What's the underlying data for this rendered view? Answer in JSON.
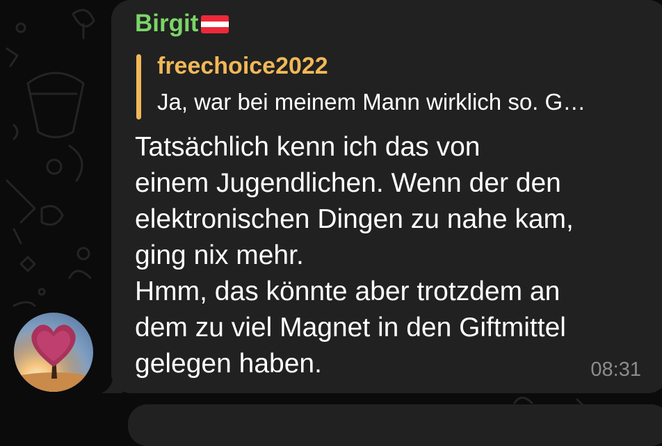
{
  "message": {
    "sender": "Birgit",
    "sender_flag": "austria-flag",
    "sender_color": "#7bd567",
    "reply": {
      "name": "freechoice2022",
      "text": "Ja, war bei meinem Mann wirklich so. G…",
      "accent_color": "#f1b858"
    },
    "lines": [
      "Tatsächlich kenn ich das von",
      "einem Jugendlichen. Wenn der den",
      "elektronischen Dingen zu nahe kam,",
      "ging nix mehr.",
      "Hmm, das könnte aber trotzdem an",
      "dem zu viel Magnet in den Giftmittel",
      "gelegen haben."
    ],
    "time": "08:31"
  },
  "colors": {
    "background": "#0b0b0c",
    "bubble": "#212121",
    "time": "#8c8c8c"
  },
  "avatar": {
    "icon": "heart-tree-avatar"
  }
}
